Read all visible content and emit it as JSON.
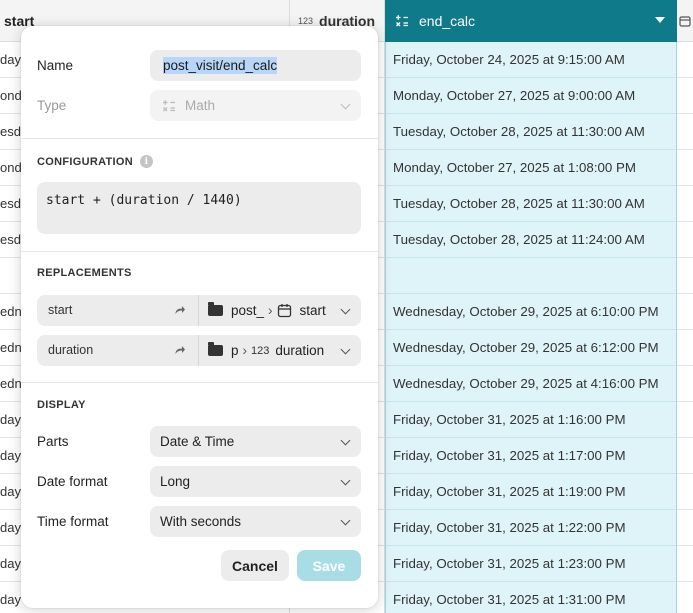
{
  "table": {
    "columns": {
      "start": "start",
      "duration": "duration",
      "duration_type": "123",
      "end_calc": "end_calc"
    },
    "start_fragments": [
      "day",
      "onda",
      "esd",
      "onda",
      "esd",
      "esd",
      "",
      "edne",
      "edne",
      "edne",
      "day",
      "day",
      "day",
      "day",
      "day",
      "day"
    ],
    "end_values": [
      "Friday, October 24, 2025 at 9:15:00 AM",
      "Monday, October 27, 2025 at 9:00:00 AM",
      "Tuesday, October 28, 2025 at 11:30:00 AM",
      "Monday, October 27, 2025 at 1:08:00 PM",
      "Tuesday, October 28, 2025 at 11:30:00 AM",
      "Tuesday, October 28, 2025 at 11:24:00 AM",
      "",
      "Wednesday, October 29, 2025 at 6:10:00 PM",
      "Wednesday, October 29, 2025 at 6:12:00 PM",
      "Wednesday, October 29, 2025 at 4:16:00 PM",
      "Friday, October 31, 2025 at 1:16:00 PM",
      "Friday, October 31, 2025 at 1:17:00 PM",
      "Friday, October 31, 2025 at 1:19:00 PM",
      "Friday, October 31, 2025 at 1:22:00 PM",
      "Friday, October 31, 2025 at 1:23:00 PM",
      "Friday, October 31, 2025 at 1:31:00 PM"
    ]
  },
  "popover": {
    "name_label": "Name",
    "name_value": "post_visit/end_calc",
    "type_label": "Type",
    "type_value": "Math",
    "configuration_title": "CONFIGURATION",
    "formula": "start + (duration / 1440)",
    "replacements_title": "REPLACEMENTS",
    "replacements": [
      {
        "key": "start",
        "folder": "post_",
        "field_type": "calendar",
        "field": "start"
      },
      {
        "key": "duration",
        "folder": "p",
        "field_type": "123",
        "field": "duration"
      }
    ],
    "display_title": "DISPLAY",
    "parts_label": "Parts",
    "parts_value": "Date & Time",
    "date_format_label": "Date format",
    "date_format_value": "Long",
    "time_format_label": "Time format",
    "time_format_value": "With seconds",
    "cancel_label": "Cancel",
    "save_label": "Save"
  },
  "colors": {
    "header_accent": "#0e7a8a",
    "selected_column_bg": "#dff4f8",
    "save_disabled": "#a9dde6",
    "text_selection": "#b8d6f7"
  }
}
